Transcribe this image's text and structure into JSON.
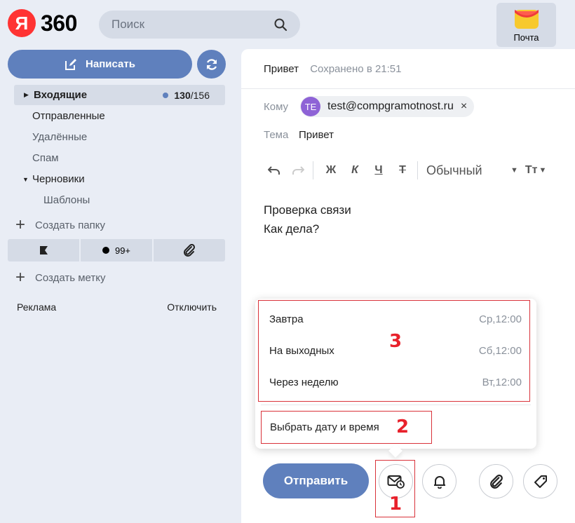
{
  "header": {
    "logo_letter": "Я",
    "logo_number": "360",
    "search_placeholder": "Поиск",
    "mail_app_label": "Почта"
  },
  "sidebar": {
    "compose_label": "Написать",
    "folders": [
      {
        "label": "Входящие",
        "unread": "130",
        "total": "/156"
      },
      {
        "label": "Отправленные"
      },
      {
        "label": "Удалённые"
      },
      {
        "label": "Спам"
      },
      {
        "label": "Черновики"
      },
      {
        "label": "Шаблоны"
      }
    ],
    "create_folder": "Создать папку",
    "labels_count": "99+",
    "create_label": "Создать метку",
    "ads_label": "Реклама",
    "ads_disable": "Отключить"
  },
  "compose": {
    "subject_title": "Привет",
    "saved_status": "Сохранено в 21:51",
    "to_label": "Кому",
    "recipient_initials": "TE",
    "recipient_email": "test@compgramotnost.ru",
    "recipient_remove": "×",
    "subject_label": "Тема",
    "subject_value": "Привет",
    "toolbar": {
      "bold": "Ж",
      "italic": "К",
      "underline": "Ч",
      "strike": "Т",
      "style": "Обычный",
      "size": "Тт"
    },
    "body_lines": [
      "Проверка связи",
      "Как дела?"
    ],
    "send_label": "Отправить"
  },
  "schedule_popup": {
    "options": [
      {
        "label": "Завтра",
        "time": "Ср,12:00"
      },
      {
        "label": "На выходных",
        "time": "Сб,12:00"
      },
      {
        "label": "Через неделю",
        "time": "Вт,12:00"
      }
    ],
    "pick_label": "Выбрать дату и время"
  },
  "annotations": {
    "marker_1": "1",
    "marker_2": "2",
    "marker_3": "3"
  },
  "colors": {
    "accent": "#5f80bd",
    "annotation_red": "#d9323a",
    "logo_red": "#ff3333",
    "avatar": "#8e63d6"
  }
}
